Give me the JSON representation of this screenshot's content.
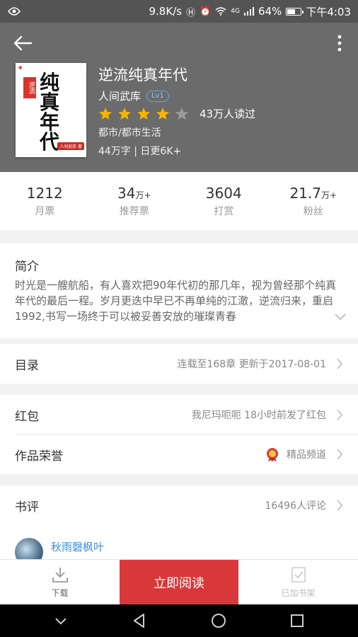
{
  "status_bar": {
    "speed": "9.8K/s",
    "network": "4G",
    "battery": "64%",
    "battery_level": 0.64,
    "time": "下午4:03"
  },
  "header": {
    "book_title": "逆流纯真年代",
    "author": "人间武库",
    "author_level": "Lv1",
    "rating_stars": 4,
    "rating_max": 5,
    "readers": "43万人读过",
    "category": "都市/都市生活",
    "word_info": "44万字 | 日更6K+",
    "cover": {
      "tag": "逆流",
      "big_title": "纯真年代",
      "stamp": "人间武库 著"
    }
  },
  "stats": [
    {
      "num": "1212",
      "suffix": "",
      "label": "月票"
    },
    {
      "num": "34",
      "suffix": "万+",
      "label": "推荐票"
    },
    {
      "num": "3604",
      "suffix": "",
      "label": "打赏"
    },
    {
      "num": "21.7",
      "suffix": "万+",
      "label": "粉丝"
    }
  ],
  "intro": {
    "heading": "简介",
    "text": "时光是一艘航船，有人喜欢把90年代初的那几年，视为曾经那个纯真年代的最后一程。岁月更迭中早已不再单纯的江澈，逆流归来，重启1992,书写一场终于可以被妥善安放的璀璨青春"
  },
  "catalog": {
    "title": "目录",
    "value": "连载至168章  更新于2017-08-01"
  },
  "redpacket": {
    "title": "红包",
    "value": "我尼玛呃呃 18小时前发了红包"
  },
  "honor": {
    "title": "作品荣誉",
    "value": "精品频道"
  },
  "reviews": {
    "title": "书评",
    "value": "16496人评论",
    "first_user": "秋雨磬枫叶"
  },
  "bottom_bar": {
    "download": "下载",
    "read_now": "立即阅读",
    "added_shelf": "已加书架"
  },
  "colors": {
    "header_bg": "#6b6b6b",
    "accent_red": "#d9383a",
    "star_gold": "#f5b400",
    "link_blue": "#3b8fd6"
  }
}
